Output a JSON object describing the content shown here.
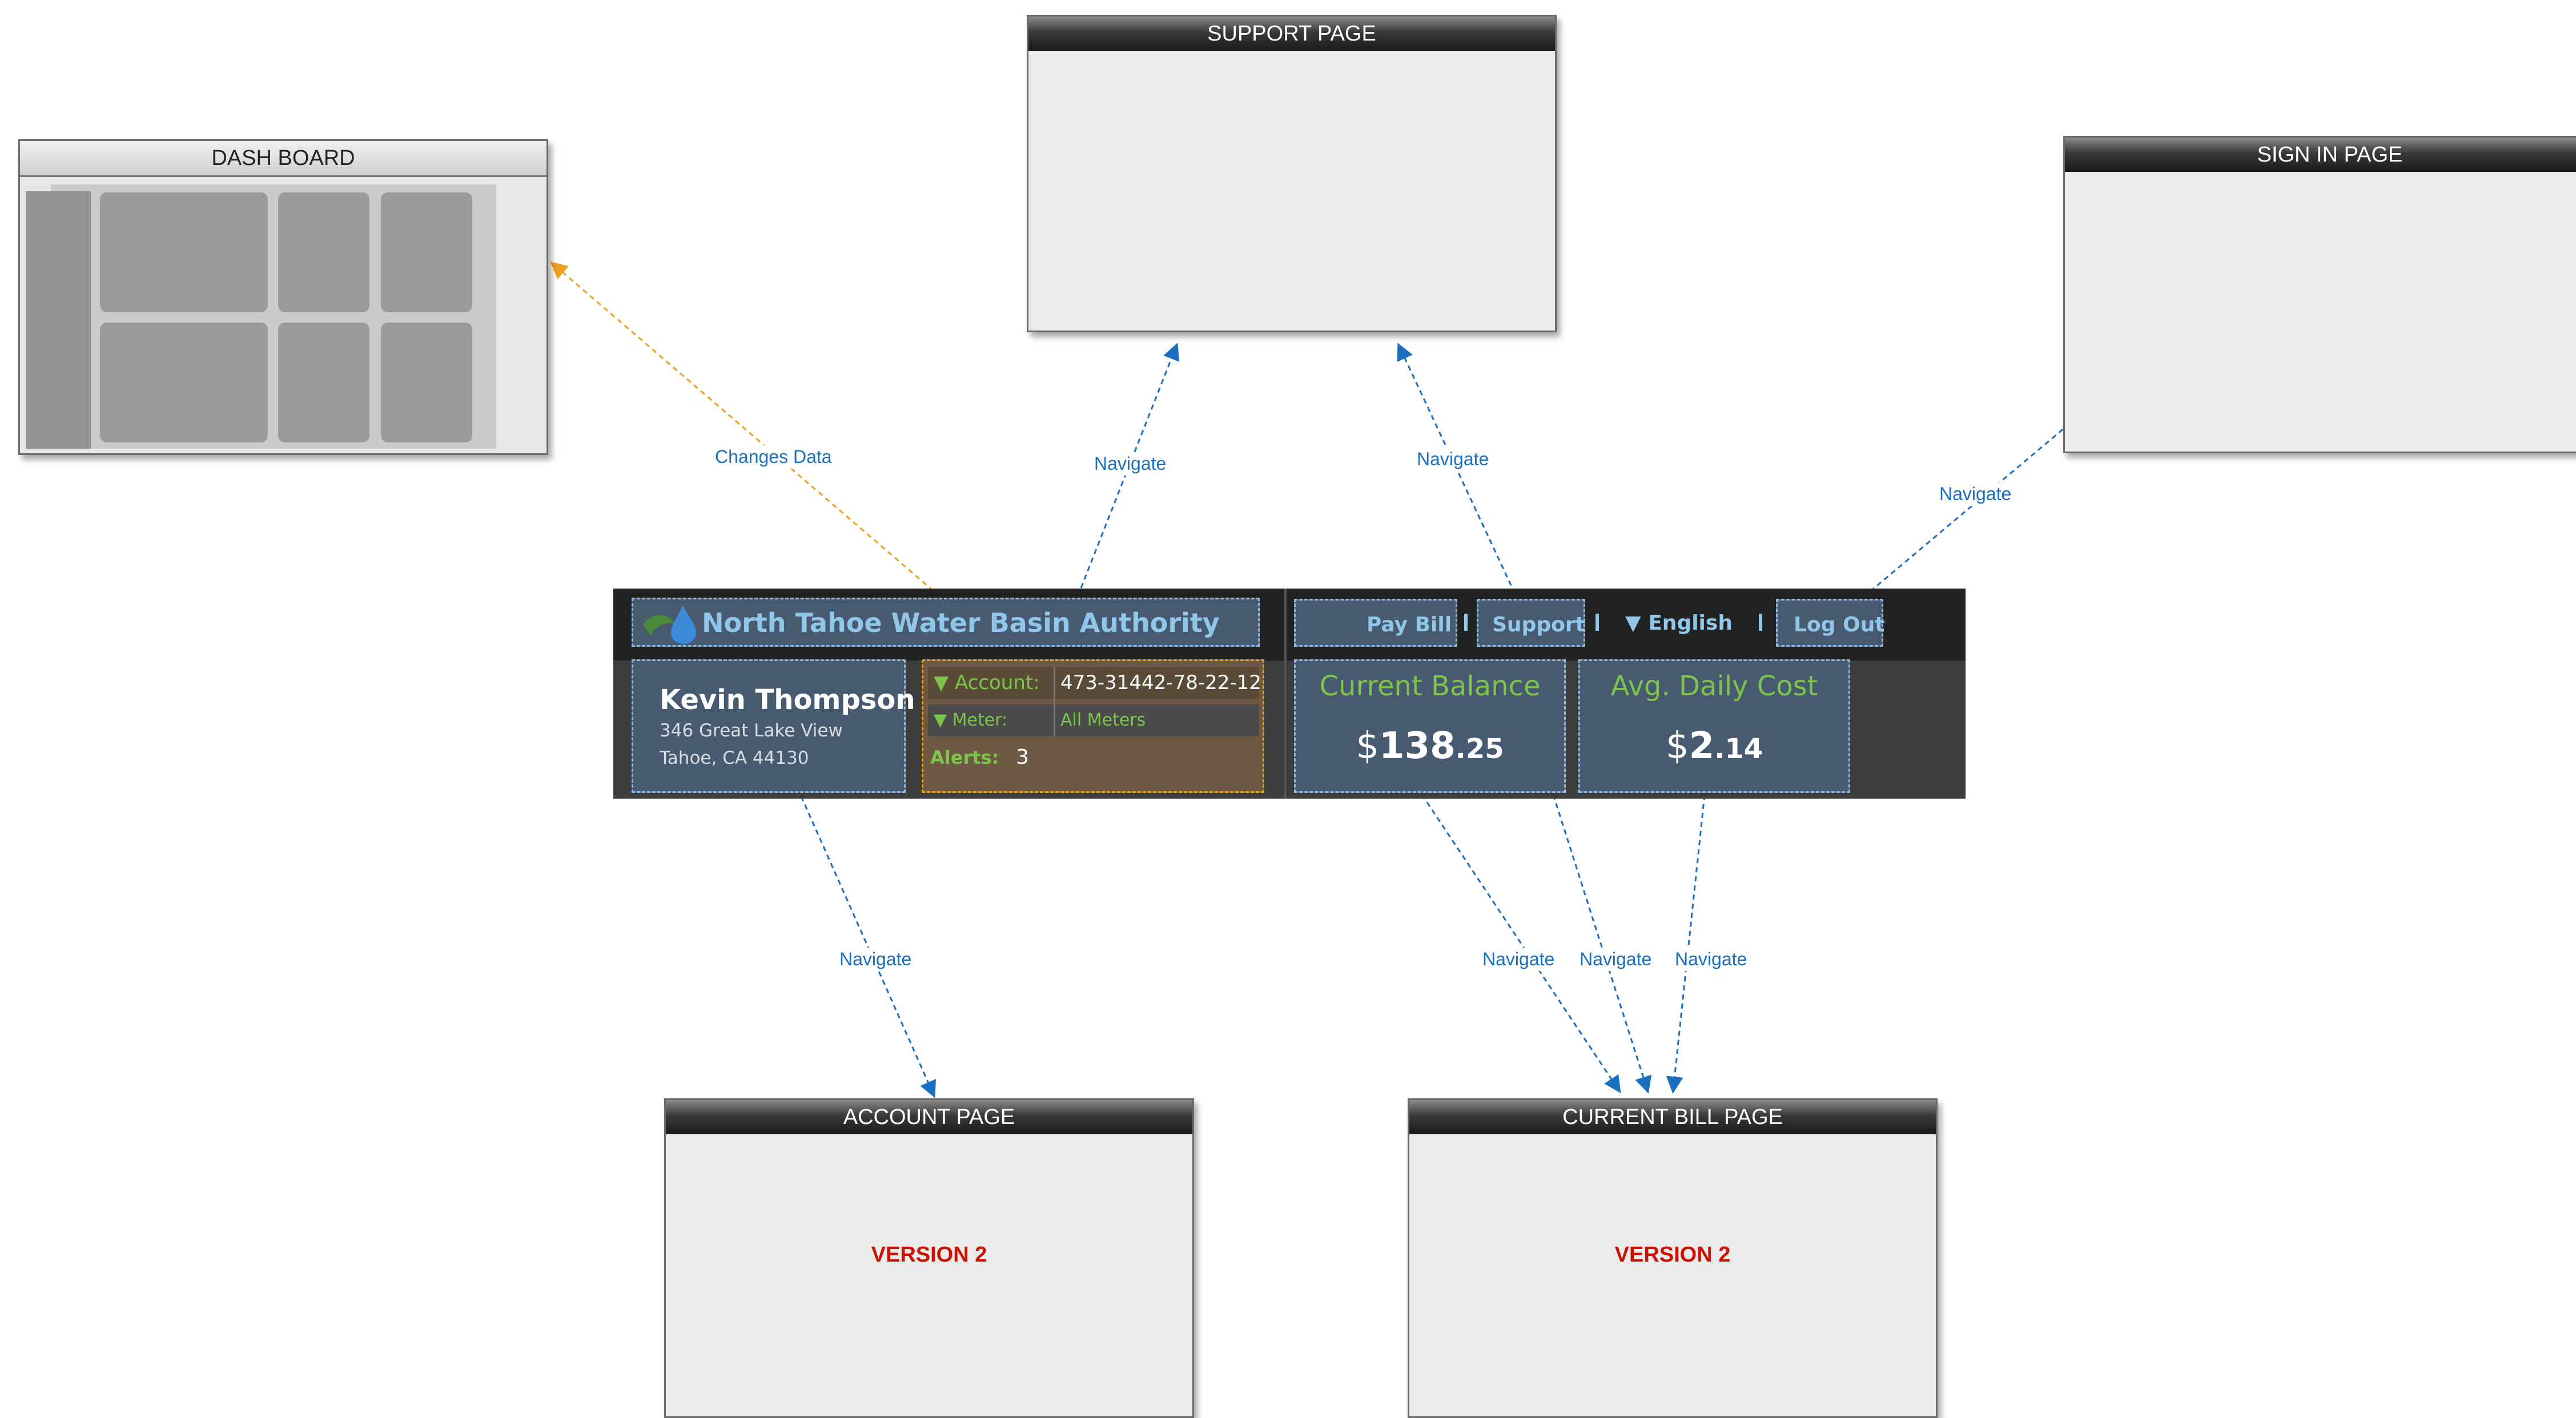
{
  "pages": {
    "dashboard": "DASH BOARD",
    "support": "SUPPORT PAGE",
    "signin": "SIGN IN PAGE",
    "account": "ACCOUNT PAGE",
    "current_bill": "CURRENT BILL PAGE",
    "version_label": "VERSION 2"
  },
  "connections": {
    "changes_data": "Changes Data",
    "navigate": "Navigate"
  },
  "header": {
    "brand": "North Tahoe Water Basin Authority",
    "nav": {
      "pay_bill": "Pay Bill",
      "support": "Support",
      "language": "▼ English",
      "logout": "Log Out"
    },
    "customer": {
      "name": "Kevin Thompson",
      "address_line1": "346 Great Lake View",
      "address_line2": "Tahoe, CA 44130"
    },
    "account": {
      "account_label": "▼ Account:",
      "account_value": "473-31442-78-22-12",
      "meter_label": "▼ Meter:",
      "meter_value": "All Meters",
      "alerts_label": "Alerts:",
      "alerts_value": "3"
    },
    "balance": {
      "label": "Current Balance",
      "dollar": "$",
      "whole": "138",
      "cents": ".25"
    },
    "daily": {
      "label": "Avg. Daily Cost",
      "dollar": "$",
      "whole": "2",
      "cents": ".14"
    }
  },
  "colors": {
    "connector_blue": "#1a6fbe",
    "connector_orange": "#f0a020",
    "version_red": "#cc1100",
    "accent_green": "#7cc44a",
    "nav_blue": "#8fc6ea"
  }
}
